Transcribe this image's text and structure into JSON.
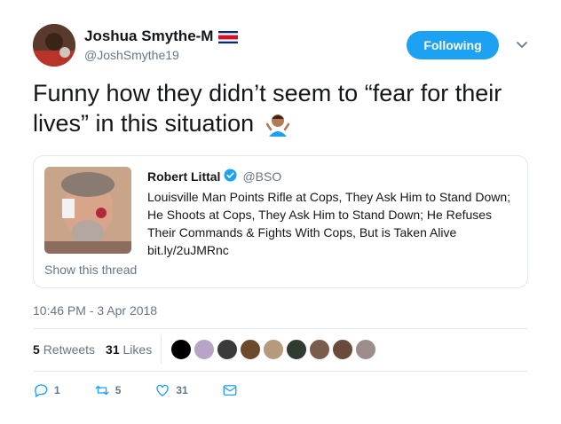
{
  "header": {
    "display_name": "Joshua Smythe-M",
    "handle": "@JoshSmythe19",
    "follow_label": "Following"
  },
  "tweet": {
    "text": "Funny how they didn’t seem to “fear for their lives” in this situation"
  },
  "quote": {
    "name": "Robert Littal",
    "handle": "@BSO",
    "body": "Louisville Man Points Rifle at Cops, They Ask Him to Stand Down; He Shoots at Cops, They Ask Him to Stand Down; He Refuses Their Commands & Fights With Cops, But is Taken Alive bit.ly/2uJMRnc",
    "show_thread": "Show this thread"
  },
  "timestamp": "10:46 PM - 3 Apr 2018",
  "stats": {
    "retweets_count": "5",
    "retweets_label": "Retweets",
    "likes_count": "31",
    "likes_label": "Likes"
  },
  "likers": [
    "#000000",
    "#b7a4c6",
    "#3a3a3a",
    "#6b4a2a",
    "#b59a7c",
    "#2f3b2f",
    "#7a5c4c",
    "#6a4a3a",
    "#9c8c8c"
  ],
  "actions": {
    "replies": "1",
    "retweets": "5",
    "likes": "31"
  },
  "colors": {
    "accent": "#1da1f2",
    "secondary_text": "#657786",
    "border": "#e1e8ed",
    "verified": "#1da1f2"
  },
  "icons": [
    "costa-rica-flag-icon",
    "chevron-down-icon",
    "person-shrugging-emoji",
    "verified-badge-icon",
    "reply-icon",
    "retweet-icon",
    "like-icon",
    "message-icon"
  ]
}
